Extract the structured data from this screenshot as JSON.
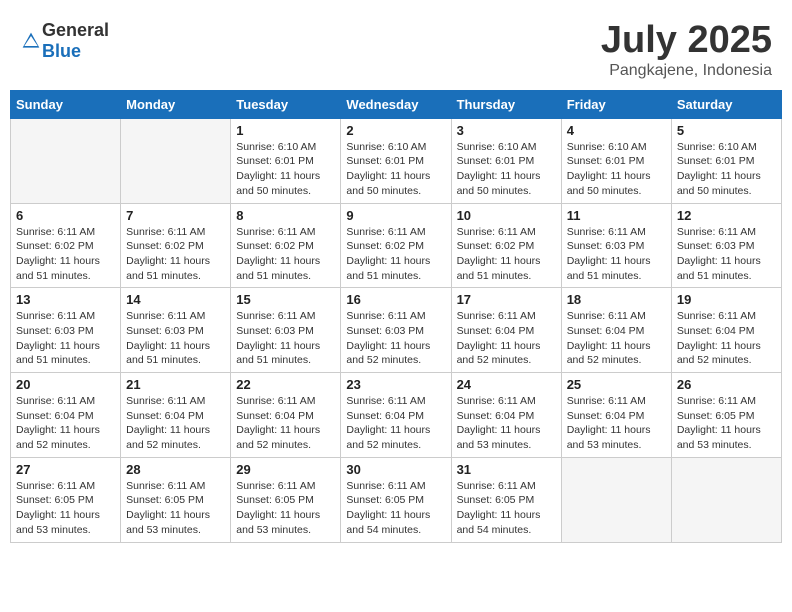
{
  "logo": {
    "general": "General",
    "blue": "Blue"
  },
  "header": {
    "month": "July 2025",
    "location": "Pangkajene, Indonesia"
  },
  "weekdays": [
    "Sunday",
    "Monday",
    "Tuesday",
    "Wednesday",
    "Thursday",
    "Friday",
    "Saturday"
  ],
  "weeks": [
    [
      {
        "day": "",
        "empty": true
      },
      {
        "day": "",
        "empty": true
      },
      {
        "day": "1",
        "sunrise": "Sunrise: 6:10 AM",
        "sunset": "Sunset: 6:01 PM",
        "daylight": "Daylight: 11 hours and 50 minutes."
      },
      {
        "day": "2",
        "sunrise": "Sunrise: 6:10 AM",
        "sunset": "Sunset: 6:01 PM",
        "daylight": "Daylight: 11 hours and 50 minutes."
      },
      {
        "day": "3",
        "sunrise": "Sunrise: 6:10 AM",
        "sunset": "Sunset: 6:01 PM",
        "daylight": "Daylight: 11 hours and 50 minutes."
      },
      {
        "day": "4",
        "sunrise": "Sunrise: 6:10 AM",
        "sunset": "Sunset: 6:01 PM",
        "daylight": "Daylight: 11 hours and 50 minutes."
      },
      {
        "day": "5",
        "sunrise": "Sunrise: 6:10 AM",
        "sunset": "Sunset: 6:01 PM",
        "daylight": "Daylight: 11 hours and 50 minutes."
      }
    ],
    [
      {
        "day": "6",
        "sunrise": "Sunrise: 6:11 AM",
        "sunset": "Sunset: 6:02 PM",
        "daylight": "Daylight: 11 hours and 51 minutes."
      },
      {
        "day": "7",
        "sunrise": "Sunrise: 6:11 AM",
        "sunset": "Sunset: 6:02 PM",
        "daylight": "Daylight: 11 hours and 51 minutes."
      },
      {
        "day": "8",
        "sunrise": "Sunrise: 6:11 AM",
        "sunset": "Sunset: 6:02 PM",
        "daylight": "Daylight: 11 hours and 51 minutes."
      },
      {
        "day": "9",
        "sunrise": "Sunrise: 6:11 AM",
        "sunset": "Sunset: 6:02 PM",
        "daylight": "Daylight: 11 hours and 51 minutes."
      },
      {
        "day": "10",
        "sunrise": "Sunrise: 6:11 AM",
        "sunset": "Sunset: 6:02 PM",
        "daylight": "Daylight: 11 hours and 51 minutes."
      },
      {
        "day": "11",
        "sunrise": "Sunrise: 6:11 AM",
        "sunset": "Sunset: 6:03 PM",
        "daylight": "Daylight: 11 hours and 51 minutes."
      },
      {
        "day": "12",
        "sunrise": "Sunrise: 6:11 AM",
        "sunset": "Sunset: 6:03 PM",
        "daylight": "Daylight: 11 hours and 51 minutes."
      }
    ],
    [
      {
        "day": "13",
        "sunrise": "Sunrise: 6:11 AM",
        "sunset": "Sunset: 6:03 PM",
        "daylight": "Daylight: 11 hours and 51 minutes."
      },
      {
        "day": "14",
        "sunrise": "Sunrise: 6:11 AM",
        "sunset": "Sunset: 6:03 PM",
        "daylight": "Daylight: 11 hours and 51 minutes."
      },
      {
        "day": "15",
        "sunrise": "Sunrise: 6:11 AM",
        "sunset": "Sunset: 6:03 PM",
        "daylight": "Daylight: 11 hours and 51 minutes."
      },
      {
        "day": "16",
        "sunrise": "Sunrise: 6:11 AM",
        "sunset": "Sunset: 6:03 PM",
        "daylight": "Daylight: 11 hours and 52 minutes."
      },
      {
        "day": "17",
        "sunrise": "Sunrise: 6:11 AM",
        "sunset": "Sunset: 6:04 PM",
        "daylight": "Daylight: 11 hours and 52 minutes."
      },
      {
        "day": "18",
        "sunrise": "Sunrise: 6:11 AM",
        "sunset": "Sunset: 6:04 PM",
        "daylight": "Daylight: 11 hours and 52 minutes."
      },
      {
        "day": "19",
        "sunrise": "Sunrise: 6:11 AM",
        "sunset": "Sunset: 6:04 PM",
        "daylight": "Daylight: 11 hours and 52 minutes."
      }
    ],
    [
      {
        "day": "20",
        "sunrise": "Sunrise: 6:11 AM",
        "sunset": "Sunset: 6:04 PM",
        "daylight": "Daylight: 11 hours and 52 minutes."
      },
      {
        "day": "21",
        "sunrise": "Sunrise: 6:11 AM",
        "sunset": "Sunset: 6:04 PM",
        "daylight": "Daylight: 11 hours and 52 minutes."
      },
      {
        "day": "22",
        "sunrise": "Sunrise: 6:11 AM",
        "sunset": "Sunset: 6:04 PM",
        "daylight": "Daylight: 11 hours and 52 minutes."
      },
      {
        "day": "23",
        "sunrise": "Sunrise: 6:11 AM",
        "sunset": "Sunset: 6:04 PM",
        "daylight": "Daylight: 11 hours and 52 minutes."
      },
      {
        "day": "24",
        "sunrise": "Sunrise: 6:11 AM",
        "sunset": "Sunset: 6:04 PM",
        "daylight": "Daylight: 11 hours and 53 minutes."
      },
      {
        "day": "25",
        "sunrise": "Sunrise: 6:11 AM",
        "sunset": "Sunset: 6:04 PM",
        "daylight": "Daylight: 11 hours and 53 minutes."
      },
      {
        "day": "26",
        "sunrise": "Sunrise: 6:11 AM",
        "sunset": "Sunset: 6:05 PM",
        "daylight": "Daylight: 11 hours and 53 minutes."
      }
    ],
    [
      {
        "day": "27",
        "sunrise": "Sunrise: 6:11 AM",
        "sunset": "Sunset: 6:05 PM",
        "daylight": "Daylight: 11 hours and 53 minutes."
      },
      {
        "day": "28",
        "sunrise": "Sunrise: 6:11 AM",
        "sunset": "Sunset: 6:05 PM",
        "daylight": "Daylight: 11 hours and 53 minutes."
      },
      {
        "day": "29",
        "sunrise": "Sunrise: 6:11 AM",
        "sunset": "Sunset: 6:05 PM",
        "daylight": "Daylight: 11 hours and 53 minutes."
      },
      {
        "day": "30",
        "sunrise": "Sunrise: 6:11 AM",
        "sunset": "Sunset: 6:05 PM",
        "daylight": "Daylight: 11 hours and 54 minutes."
      },
      {
        "day": "31",
        "sunrise": "Sunrise: 6:11 AM",
        "sunset": "Sunset: 6:05 PM",
        "daylight": "Daylight: 11 hours and 54 minutes."
      },
      {
        "day": "",
        "empty": true
      },
      {
        "day": "",
        "empty": true
      }
    ]
  ]
}
